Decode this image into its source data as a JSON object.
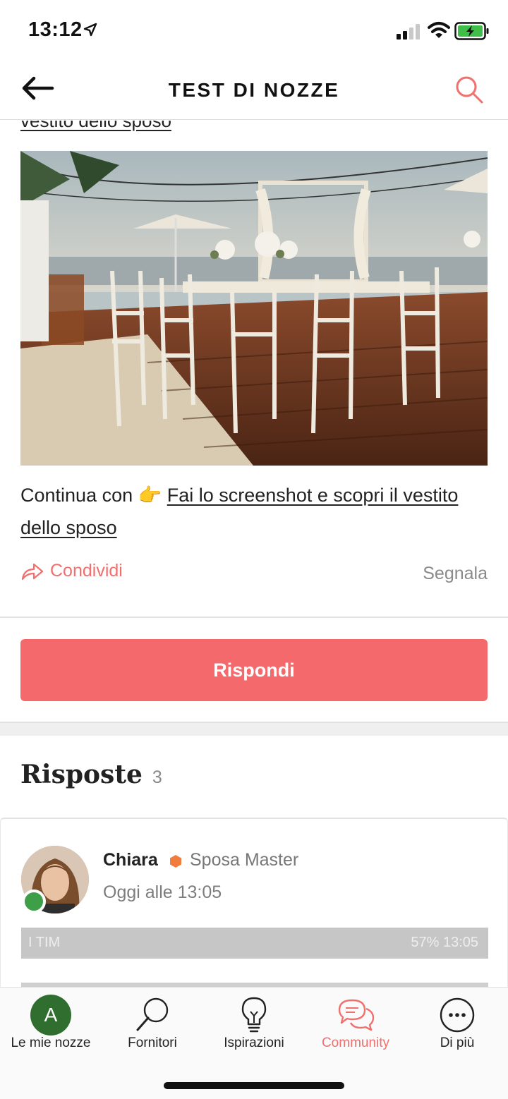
{
  "status_bar": {
    "time": "13:12"
  },
  "nav": {
    "title": "TEST DI NOZZE"
  },
  "post": {
    "clipped_link": "vestito dello sposo",
    "text_prefix": "Continua con 👉 ",
    "link_text": "Fai lo screenshot e scopri il vestito dello sposo",
    "share_label": "Condividi",
    "report_label": "Segnala"
  },
  "reply_button": {
    "label": "Rispondi"
  },
  "answers": {
    "title": "Risposte",
    "count": "3",
    "items": [
      {
        "author": "Chiara",
        "rank": "Sposa Master",
        "time": "Oggi alle 13:05",
        "embedded_left": "I TIM",
        "embedded_right": "57%  13:05"
      }
    ]
  },
  "tab_bar": {
    "tabs": [
      {
        "label": "Le mie nozze",
        "icon": "avatar-icon",
        "avatar_letter": "A"
      },
      {
        "label": "Fornitori",
        "icon": "search-icon"
      },
      {
        "label": "Ispirazioni",
        "icon": "lightbulb-icon"
      },
      {
        "label": "Community",
        "icon": "chat-bubbles-icon",
        "active": true
      },
      {
        "label": "Di più",
        "icon": "more-icon"
      }
    ]
  },
  "colors": {
    "accent": "#f3696c",
    "online": "#3f9f49",
    "avatar_bg": "#2f6e2f"
  }
}
